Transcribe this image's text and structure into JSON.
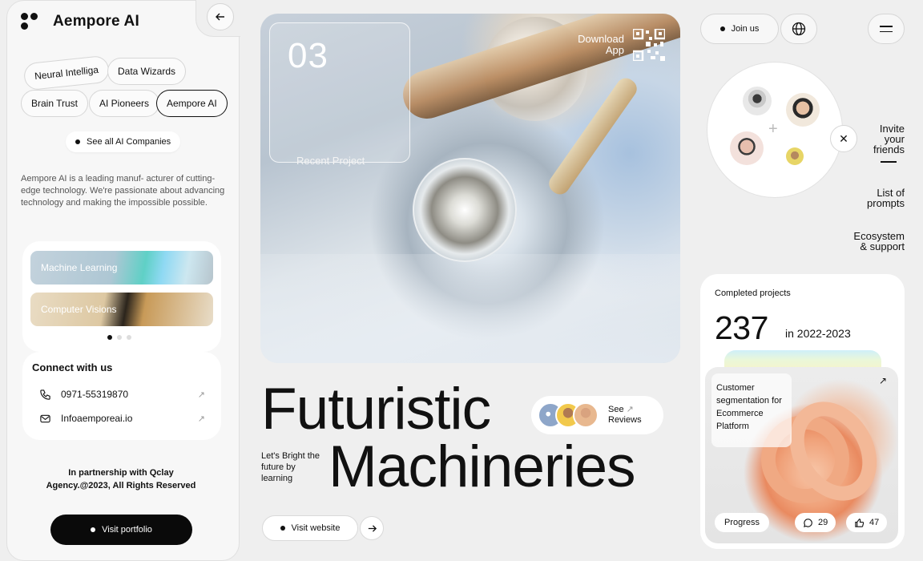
{
  "brand": {
    "name": "Aempore AI"
  },
  "companies": {
    "chips": [
      "Neural Intelliga",
      "Data Wizards",
      "Brain Trust",
      "AI Pioneers",
      "Aempore AI"
    ],
    "see_all": "See all AI Companies"
  },
  "about": "Aempore AI is a leading manuf- acturer of cutting-edge technology. We're passionate about advancing technology and making the impossible possible.",
  "media": {
    "items": [
      "Machine Learning",
      "Computer Visions"
    ]
  },
  "connect": {
    "title": "Connect with us",
    "phone": "0971-55319870",
    "email": "Infoaemporeai.io"
  },
  "partnership": "In partnership with Qclay Agency.@2023, All Rights Reserved",
  "visit_portfolio": "Visit portfolio",
  "hero": {
    "number": "03",
    "recent": "Recent Project",
    "download_line1": "Download",
    "download_line2": "App"
  },
  "headline": {
    "line1": "Futuristic",
    "line2": "Machineries"
  },
  "tagline": "Let's Bright the future by learning",
  "reviews": {
    "line1": "See",
    "line2": "Reviews"
  },
  "visit_website": "Visit website",
  "header": {
    "join": "Join us"
  },
  "side_nav": {
    "invite": [
      "Invite",
      "your",
      "friends"
    ],
    "prompts": [
      "List of",
      "prompts"
    ],
    "ecosystem": [
      "Ecosystem",
      "& support"
    ]
  },
  "projects": {
    "label": "Completed projects",
    "count": "237",
    "period": "in 2022-2023",
    "card_title": "Customer segmentation for Ecommerce Platform",
    "progress": "Progress",
    "comments": "29",
    "likes": "47"
  }
}
